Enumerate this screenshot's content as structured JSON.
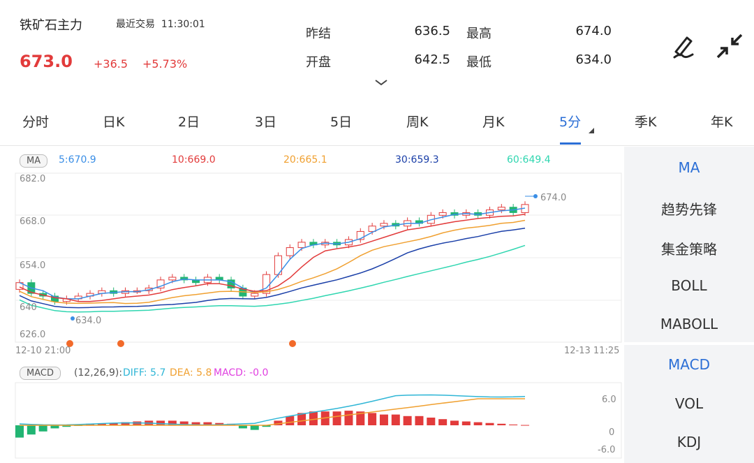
{
  "header": {
    "name": "铁矿石主力",
    "last_trade_label": "最近交易",
    "time": "11:30:01",
    "price": "673.0",
    "change": "+36.5",
    "change_pct": "+5.73%",
    "quote": [
      {
        "label": "昨结",
        "value": "636.5"
      },
      {
        "label": "最高",
        "value": "674.0"
      },
      {
        "label": "开盘",
        "value": "642.5"
      },
      {
        "label": "最低",
        "value": "634.0"
      }
    ]
  },
  "tabs": [
    "分时",
    "日K",
    "2日",
    "3日",
    "5日",
    "周K",
    "月K",
    "5分",
    "季K",
    "年K"
  ],
  "active_tab": "5分",
  "ma": {
    "badge": "MA",
    "values": [
      {
        "label": "5:670.9",
        "color": "#3a8ee6"
      },
      {
        "label": "10:669.0",
        "color": "#e23b3b"
      },
      {
        "label": "20:665.1",
        "color": "#f0a030"
      },
      {
        "label": "30:659.3",
        "color": "#1a3fa8"
      },
      {
        "label": "60:649.4",
        "color": "#2fd6b0"
      }
    ]
  },
  "main_chart": {
    "y_labels": [
      "682.0",
      "668.0",
      "654.0",
      "640",
      "626.0"
    ],
    "high_label": "674.0",
    "low_label": "634.0",
    "x_start": "12-10 21:00",
    "x_end": "12-13 11:25"
  },
  "macd": {
    "badge": "MACD",
    "params": "(12,26,9):",
    "diff": "DIFF: 5.7",
    "dea": "DEA: 5.8",
    "macd": "MACD: -0.0",
    "y_labels": [
      "6.0",
      "0",
      "-6.0"
    ]
  },
  "sidebar_top": [
    "MA",
    "趋势先锋",
    "集金策略",
    "BOLL",
    "MABOLL"
  ],
  "sidebar_bottom": [
    "MACD",
    "VOL",
    "KDJ"
  ],
  "colors": {
    "up": "#e23b3b",
    "down": "#22b573",
    "accent": "#2c6fd6"
  }
}
